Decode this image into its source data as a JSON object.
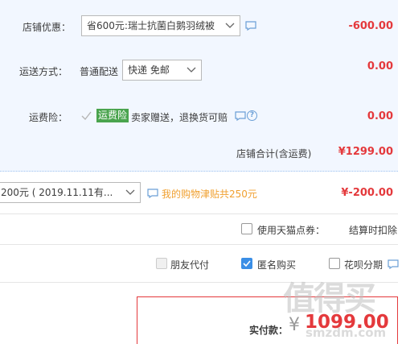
{
  "shop_discount": {
    "label": "店铺优惠：",
    "selected": "省600元:瑞士抗菌白鹅羽绒被",
    "amount": "-600.00"
  },
  "shipping": {
    "label": "运送方式：",
    "method_text": "普通配送",
    "selected": "快递 免邮",
    "amount": "0.00"
  },
  "insurance": {
    "label": "运费险：",
    "tag": "运费险",
    "text": "卖家赠送，退换货可赔",
    "amount": "0.00"
  },
  "shop_total": {
    "label": "店铺合计(含运费)",
    "amount": "¥1299.00"
  },
  "coupon": {
    "selected": "200元 ( 2019.11.11有...",
    "allowance_text": "我的购物津贴共250元",
    "amount": "¥-200.00"
  },
  "tmall_points": {
    "label": "使用天猫点券：",
    "note": "结算时扣除"
  },
  "options": {
    "friend_pay": "朋友代付",
    "anonymous": "匿名购买",
    "installment": "花呗分期"
  },
  "payment": {
    "label": "实付款：",
    "currency": "¥",
    "amount": "1099.00"
  },
  "watermark": {
    "logo": "值得买",
    "url": "smzdm.com"
  }
}
